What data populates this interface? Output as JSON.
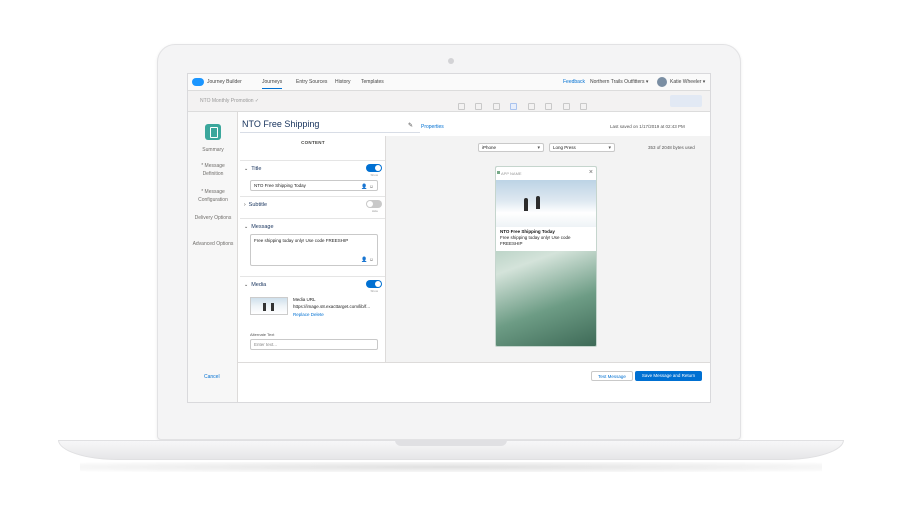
{
  "topnav": {
    "app_name": "Journey Builder",
    "tabs": [
      "Journeys",
      "Entry Sources",
      "History",
      "Templates"
    ],
    "feedback": "Feedback",
    "business_unit": "Northern Trails Outfitters ▾",
    "user": "Katie Wheeler ▾"
  },
  "journey": {
    "name": "NTO Monthly Promotion ✓"
  },
  "sidebar": {
    "items": [
      "Summary",
      "* Message Definition",
      "* Message Configuration",
      "Delivery Options",
      "Advanced Options"
    ],
    "cancel": "Cancel"
  },
  "editor": {
    "title": "NTO Free Shipping",
    "properties": "Properties",
    "last_saved": "Last saved on 1/17/2019 at 02:43 PM"
  },
  "content": {
    "header": "CONTENT",
    "title_section": {
      "label": "Title",
      "value": "NTO Free Shipping Today",
      "toggle_label": "Show"
    },
    "subtitle_section": {
      "label": "Subtitle",
      "toggle_label": "Hide"
    },
    "message_section": {
      "label": "Message",
      "value": "Free shipping today only! Use code FREESHIP"
    },
    "media_section": {
      "label": "Media",
      "toggle_label": "Show",
      "url_label": "Media URL",
      "url_value": "https://image.s8.exacttarget.com/lib/f...",
      "links": "Replace  Delete",
      "alt_label": "Alternate Text",
      "alt_placeholder": "Enter text..."
    }
  },
  "preview": {
    "device": "iPhone",
    "mode": "Long Press",
    "bytes": "353 of 2048 bytes used",
    "notification": {
      "app": "APP NAME",
      "title": "NTO Free Shipping Today",
      "body": "Free shipping today only! Use code FREESHIP"
    }
  },
  "footer": {
    "test_button": "Test Message",
    "save_button": "Save Message and Return"
  },
  "colors": {
    "accent": "#0070d2",
    "sidebar_icon": "#3ba79c"
  }
}
